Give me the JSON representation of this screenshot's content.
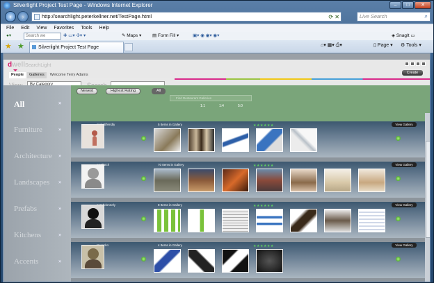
{
  "window": {
    "title": "Silverlight Project Test Page - Windows Internet Explorer"
  },
  "address": {
    "url": "http://searchlight.peterkellner.net/TestPage.html",
    "search_placeholder": "Live Search"
  },
  "menu": [
    "File",
    "Edit",
    "View",
    "Favorites",
    "Tools",
    "Help"
  ],
  "toolbar": {
    "search_placeholder": "Search we",
    "maps": "Maps",
    "formfill": "Form Fill",
    "snagit": "SnagIt"
  },
  "tab": {
    "label": "Silverlight Project Test Page"
  },
  "commands": {
    "page": "Page",
    "tools": "Tools"
  },
  "app": {
    "logo_prefix": "d",
    "logo_main": "well",
    "logo_suffix": "SearchLight",
    "create": "Create",
    "tabs": [
      "People",
      "Galleries"
    ],
    "welcome": "Welcome Terry Adams",
    "view_label": "View",
    "view_value": "By Category",
    "search_label": "Search",
    "categories": [
      "All",
      "Furniture",
      "Architecture",
      "Landscapes",
      "Prefabs",
      "Kitchens",
      "Accents"
    ],
    "filters": [
      "Newest",
      "Highest Rating",
      "All"
    ],
    "slider_label": "Find Restaurant Galleries",
    "ratios": [
      "1:1",
      "1:4",
      "5:0"
    ],
    "view_gallery": "View Gallery",
    "rows": [
      {
        "user": "maketifiendly",
        "count": "5 Items in Gallery",
        "stars": "★★★★★★"
      },
      {
        "user": "wetdarch",
        "count": "70 Items in Gallery",
        "stars": "★★★★★★"
      },
      {
        "user": "sarahdonnely",
        "count": "8 Items in Gallery",
        "stars": "★★★★★★"
      },
      {
        "user": "tzerocko",
        "count": "4 Items in Gallery",
        "stars": "★★★★★★"
      }
    ]
  }
}
